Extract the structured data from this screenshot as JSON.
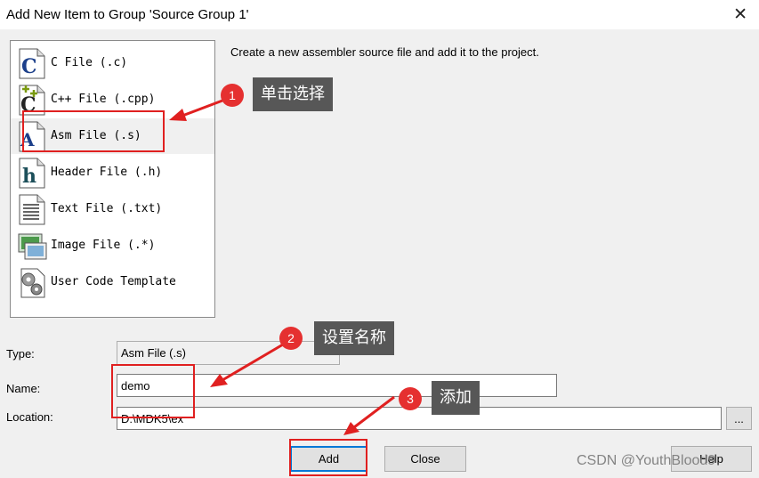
{
  "window": {
    "title": "Add New Item to Group 'Source Group 1'",
    "close_glyph": "✕"
  },
  "file_types": [
    {
      "label": "C File (.c)",
      "icon": "c-file-icon",
      "selected": false
    },
    {
      "label": "C++ File (.cpp)",
      "icon": "cpp-file-icon",
      "selected": false
    },
    {
      "label": "Asm File (.s)",
      "icon": "asm-file-icon",
      "selected": true
    },
    {
      "label": "Header File (.h)",
      "icon": "header-file-icon",
      "selected": false
    },
    {
      "label": "Text File (.txt)",
      "icon": "text-file-icon",
      "selected": false
    },
    {
      "label": "Image File (.*)",
      "icon": "image-file-icon",
      "selected": false
    },
    {
      "label": "User Code Template",
      "icon": "template-gear-icon",
      "selected": false
    }
  ],
  "description": "Create a new assembler source file and add it to the project.",
  "form": {
    "type_label": "Type:",
    "type_value": "Asm File (.s)",
    "name_label": "Name:",
    "name_value": "demo",
    "location_label": "Location:",
    "location_value": "D:\\MDK5\\ex",
    "browse_label": "..."
  },
  "buttons": {
    "add": "Add",
    "close": "Close",
    "help": "Help"
  },
  "annotations": {
    "step1": {
      "number": "1",
      "text": "单击选择"
    },
    "step2": {
      "number": "2",
      "text": "设置名称"
    },
    "step3": {
      "number": "3",
      "text": "添加"
    }
  },
  "watermark": "CSDN @YouthBlood9",
  "colors": {
    "annotation_red": "#e02020",
    "callout_bg": "#575757",
    "selection_bg": "#f0f0f0"
  }
}
